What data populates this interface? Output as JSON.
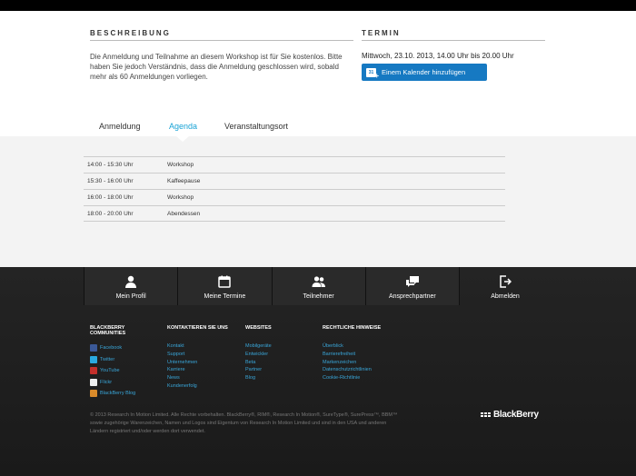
{
  "description": {
    "title": "BESCHREIBUNG",
    "text": "Die Anmeldung und Teilnahme an diesem Workshop ist für Sie kostenlos. Bitte haben Sie jedoch Verständnis, dass die Anmeldung geschlossen wird, sobald mehr als 60 Anmeldungen vorliegen."
  },
  "termin": {
    "title": "TERMIN",
    "date": "Mittwoch, 23.10. 2013, 14.00 Uhr bis 20.00 Uhr",
    "calendar_button": "Einem Kalender hinzufügen",
    "calendar_icon_text": "31"
  },
  "tabs": [
    {
      "label": "Anmeldung"
    },
    {
      "label": "Agenda"
    },
    {
      "label": "Veranstaltungsort"
    }
  ],
  "agenda": [
    {
      "time": "14:00 - 15:30 Uhr",
      "item": "Workshop"
    },
    {
      "time": "15:30 - 16:00 Uhr",
      "item": "Kaffeepause"
    },
    {
      "time": "16:00 - 18:00 Uhr",
      "item": "Workshop"
    },
    {
      "time": "18:00 - 20:00 Uhr",
      "item": "Abendessen"
    }
  ],
  "nav": [
    {
      "label": "Mein Profil",
      "icon": "user-icon"
    },
    {
      "label": "Meine Termine",
      "icon": "calendar-icon"
    },
    {
      "label": "Teilnehmer",
      "icon": "group-icon"
    },
    {
      "label": "Ansprechpartner",
      "icon": "chat-icon"
    }
  ],
  "logout": {
    "label": "Abmelden",
    "icon": "logout-icon"
  },
  "footer": {
    "communities": {
      "title": "BLACKBERRY COMMUNITIES",
      "links": [
        "Facebook",
        "Twitter",
        "YouTube",
        "Flickr",
        "BlackBerry Blog"
      ]
    },
    "contact": {
      "title": "KONTAKTIEREN SIE UNS",
      "links": [
        "Kontakt",
        "Support",
        "Unternehmen",
        "Karriere",
        "News",
        "Kundenerfolg"
      ]
    },
    "websites": {
      "title": "WEBSITES",
      "links": [
        "Mobilgeräte",
        "Entwickler",
        "Beta",
        "Partner",
        "Blog"
      ]
    },
    "legal": {
      "title": "RECHTLICHE HINWEISE",
      "links": [
        "Überblick",
        "Barrierefreiheit",
        "Markenzeichen",
        "Datenschutzrichtlinien",
        "Cookie-Richtlinie"
      ]
    },
    "copyright": "© 2013 Research In Motion Limited. Alle Rechte vorbehalten. BlackBerry®, RIM®, Research In Motion®, SureType®, SurePress™, BBM™ sowie zugehörige Warenzeichen, Namen und Logos sind Eigentum von Research In Motion Limited und sind in den USA und anderen Ländern registriert und/oder werden dort verwendet.",
    "brand": "BlackBerry"
  },
  "colors": {
    "accent": "#19a3d6",
    "button": "#1679c2",
    "link": "#39a6d9"
  }
}
